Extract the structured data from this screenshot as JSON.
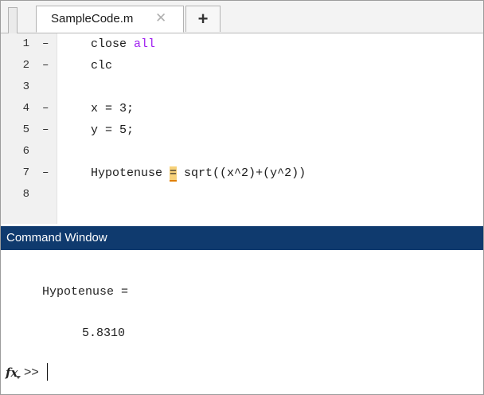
{
  "editor": {
    "tabs": [
      {
        "label": "SampleCode.m",
        "close_glyph": "✕"
      }
    ],
    "add_tab_glyph": "+",
    "lines": [
      {
        "num": "1",
        "dash": "–",
        "code": "close ",
        "kw": "all"
      },
      {
        "num": "2",
        "dash": "–",
        "code": "clc"
      },
      {
        "num": "3",
        "dash": "",
        "code": ""
      },
      {
        "num": "4",
        "dash": "–",
        "code": "x = 3;"
      },
      {
        "num": "5",
        "dash": "–",
        "code": "y = 5;"
      },
      {
        "num": "6",
        "dash": "",
        "code": ""
      },
      {
        "num": "7",
        "dash": "–",
        "code_before": "Hypotenuse ",
        "highlight": "=",
        "code_after": " sqrt((x^2)+(y^2))"
      },
      {
        "num": "8",
        "dash": "",
        "code": ""
      }
    ]
  },
  "command_window": {
    "title": "Command Window",
    "output_name": "Hypotenuse =",
    "output_value": "5.8310",
    "fx_label": "fx",
    "prompt": ">>"
  },
  "colors": {
    "keyword": "#a020f0",
    "title_bar": "#0f3a6e",
    "highlight": "#f7d27a",
    "gutter": "#f1f1f1"
  }
}
